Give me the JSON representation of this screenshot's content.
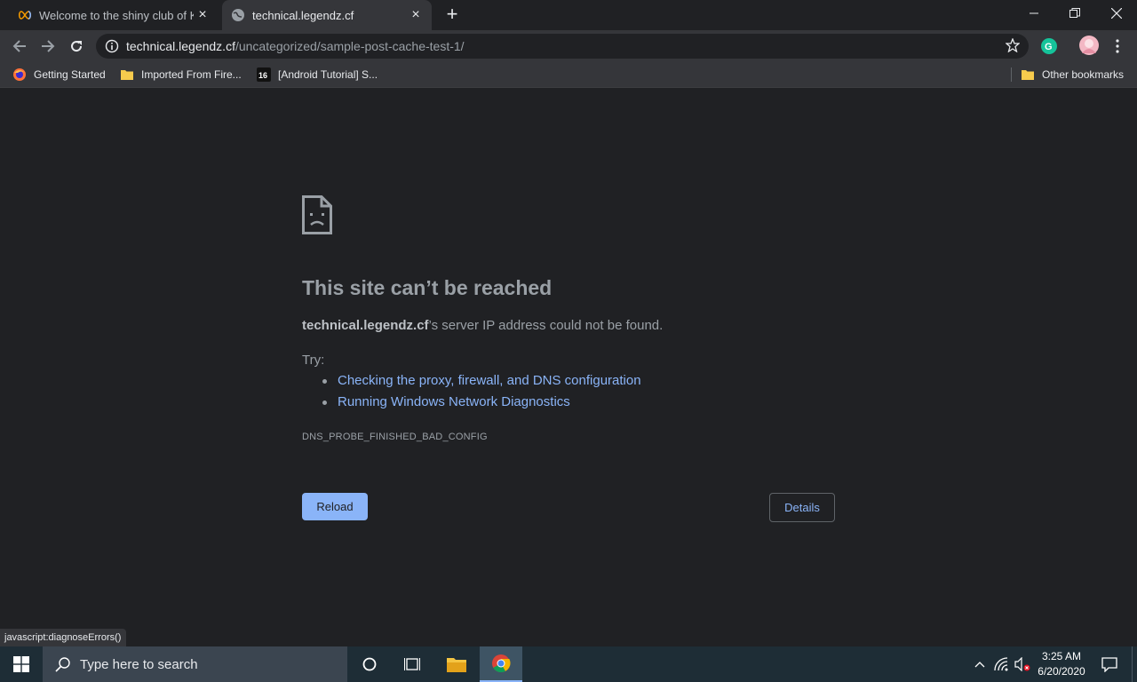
{
  "tabs": [
    {
      "title": "Welcome to the shiny club of Kirl",
      "close": "×"
    },
    {
      "title": "technical.legendz.cf",
      "close": "×"
    }
  ],
  "new_tab_label": "+",
  "address_bar": {
    "host": "technical.legendz.cf",
    "path": "/uncategorized/sample-post-cache-test-1/"
  },
  "bookmarks": [
    {
      "label": "Getting Started",
      "icon": "firefox-icon"
    },
    {
      "label": "Imported From Fire...",
      "icon": "folder-icon"
    },
    {
      "label": "[Android Tutorial] S...",
      "icon": "site-icon"
    },
    {
      "label": "Other bookmarks",
      "icon": "folder-icon"
    }
  ],
  "error": {
    "title": "This site can’t be reached",
    "host": "technical.legendz.cf",
    "message": "’s server IP address could not be found.",
    "try_label": "Try:",
    "suggestions": [
      "Checking the proxy, firewall, and DNS configuration",
      "Running Windows Network Diagnostics"
    ],
    "code": "DNS_PROBE_FINISHED_BAD_CONFIG",
    "reload_label": "Reload",
    "details_label": "Details"
  },
  "status_bar": "javascript:diagnoseErrors()",
  "taskbar": {
    "search_placeholder": "Type here to search",
    "time": "3:25 AM",
    "date": "6/20/2020"
  },
  "colors": {
    "page_background": "#202124",
    "link": "#8ab4f8",
    "toolbar": "#35363a",
    "taskbar": "#1e2d36"
  }
}
